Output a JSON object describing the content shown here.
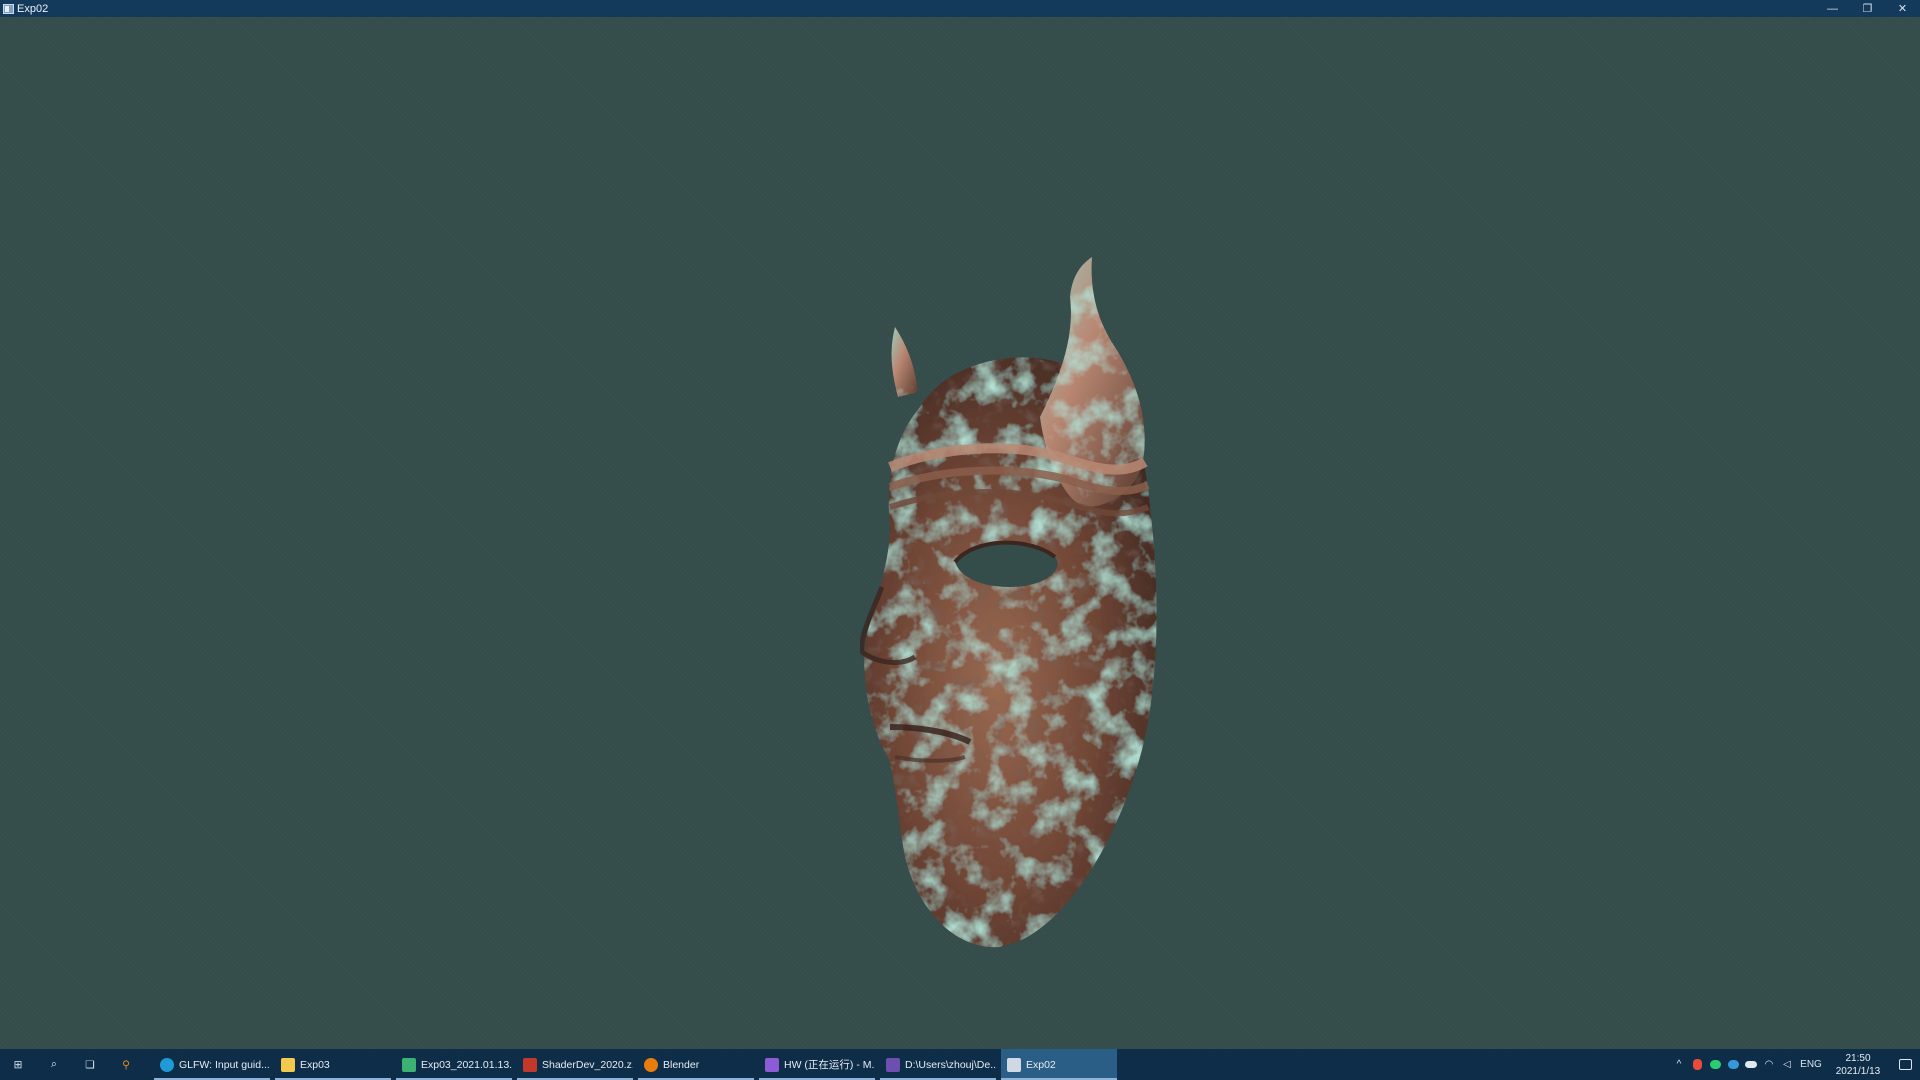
{
  "window": {
    "title": "Exp02",
    "controls": {
      "minimize": "—",
      "restore": "❐",
      "close": "✕"
    }
  },
  "scene": {
    "background_color": "#344c4a",
    "object": "bronze-mask-icon"
  },
  "taskbar": {
    "pinned": [
      {
        "name": "start-icon",
        "glyph": "⊞"
      },
      {
        "name": "search-icon",
        "glyph": "⌕"
      },
      {
        "name": "task-view-icon",
        "glyph": "❏"
      },
      {
        "name": "everything-search-icon",
        "glyph": "⚲"
      }
    ],
    "apps": [
      {
        "label": "GLFW: Input guid...",
        "icon": "edge-icon",
        "color": "#1e9bd7"
      },
      {
        "label": "Exp03",
        "icon": "folder-icon",
        "color": "#f2c94c"
      },
      {
        "label": "Exp03_2021.01.13...",
        "icon": "image-viewer-icon",
        "color": "#3bb273"
      },
      {
        "label": "ShaderDev_2020.z...",
        "icon": "archive-icon",
        "color": "#c0392b"
      },
      {
        "label": "Blender",
        "icon": "blender-icon",
        "color": "#e87d0d"
      },
      {
        "label": "HW (正在运行) - M...",
        "icon": "visual-studio-icon",
        "color": "#8e5bd6"
      },
      {
        "label": "D:\\Users\\zhouj\\De...",
        "icon": "vs-console-icon",
        "color": "#6d4fb0"
      },
      {
        "label": "Exp02",
        "icon": "app-window-icon",
        "color": "#cfd8e3"
      }
    ],
    "active_index": 7,
    "tray": {
      "language": "ENG",
      "time": "21:50",
      "date": "2021/1/13"
    }
  }
}
